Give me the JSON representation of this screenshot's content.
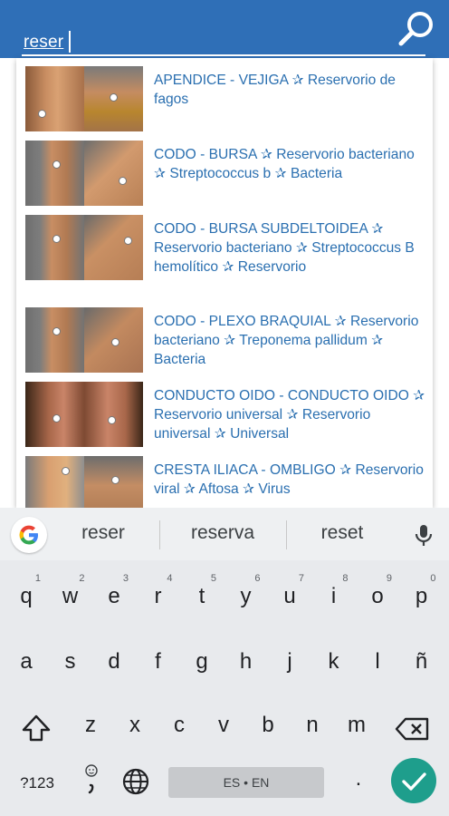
{
  "search": {
    "query": "reser",
    "search_button_icon": "magnifier-icon"
  },
  "results": [
    {
      "text": "APENDICE - VEJIGA ✰ Reservorio de fagos",
      "thumb": [
        "torso-front",
        "pelvis-front"
      ]
    },
    {
      "text": "CODO - BURSA ✰ Reservorio bacteriano ✰ Streptococcus b ✰ Bacteria",
      "thumb": [
        "arm-front",
        "shoulder-back"
      ]
    },
    {
      "text": "CODO - BURSA SUBDELTOIDEA ✰ Reservorio bacteriano ✰ Streptococcus B hemolítico ✰ Reservorio",
      "thumb": [
        "arm-front",
        "shoulder-side"
      ]
    },
    {
      "text": "CODO - PLEXO BRAQUIAL ✰ Reservorio bacteriano ✰ Treponema pallidum ✰ Bacteria",
      "thumb": [
        "arm-front",
        "shoulder-front"
      ]
    },
    {
      "text": "CONDUCTO OIDO - CONDUCTO OIDO ✰ Reservorio universal ✰ Reservorio universal ✰ Universal",
      "thumb": [
        "ear-left",
        "ear-right"
      ]
    },
    {
      "text": "CRESTA ILIACA - OMBLIGO ✰ Reservorio viral ✰ Aftosa  ✰ Virus",
      "thumb": [
        "hip-side",
        "abdomen-front"
      ]
    }
  ],
  "keyboard": {
    "suggestions": [
      "reser",
      "reserva",
      "reset"
    ],
    "row1": [
      {
        "k": "q",
        "s": "1"
      },
      {
        "k": "w",
        "s": "2"
      },
      {
        "k": "e",
        "s": "3"
      },
      {
        "k": "r",
        "s": "4"
      },
      {
        "k": "t",
        "s": "5"
      },
      {
        "k": "y",
        "s": "6"
      },
      {
        "k": "u",
        "s": "7"
      },
      {
        "k": "i",
        "s": "8"
      },
      {
        "k": "o",
        "s": "9"
      },
      {
        "k": "p",
        "s": "0"
      }
    ],
    "row2": [
      "a",
      "s",
      "d",
      "f",
      "g",
      "h",
      "j",
      "k",
      "l",
      "ñ"
    ],
    "row3": [
      "z",
      "x",
      "c",
      "v",
      "b",
      "n",
      "m"
    ],
    "symbols_label": "?123",
    "space_label": "ES • EN",
    "period_label": ".",
    "icons": {
      "google": "google-g-icon",
      "mic": "microphone-icon",
      "shift": "shift-arrow-icon",
      "backspace": "backspace-icon",
      "emoji": "emoji-comma-icon",
      "globe": "globe-icon",
      "enter": "checkmark-icon"
    }
  },
  "colors": {
    "app_bar": "#2f6fb7",
    "result_text": "#2a6fb0",
    "keyboard_bg": "#e8eaed",
    "enter_key": "#1e9e8c"
  }
}
